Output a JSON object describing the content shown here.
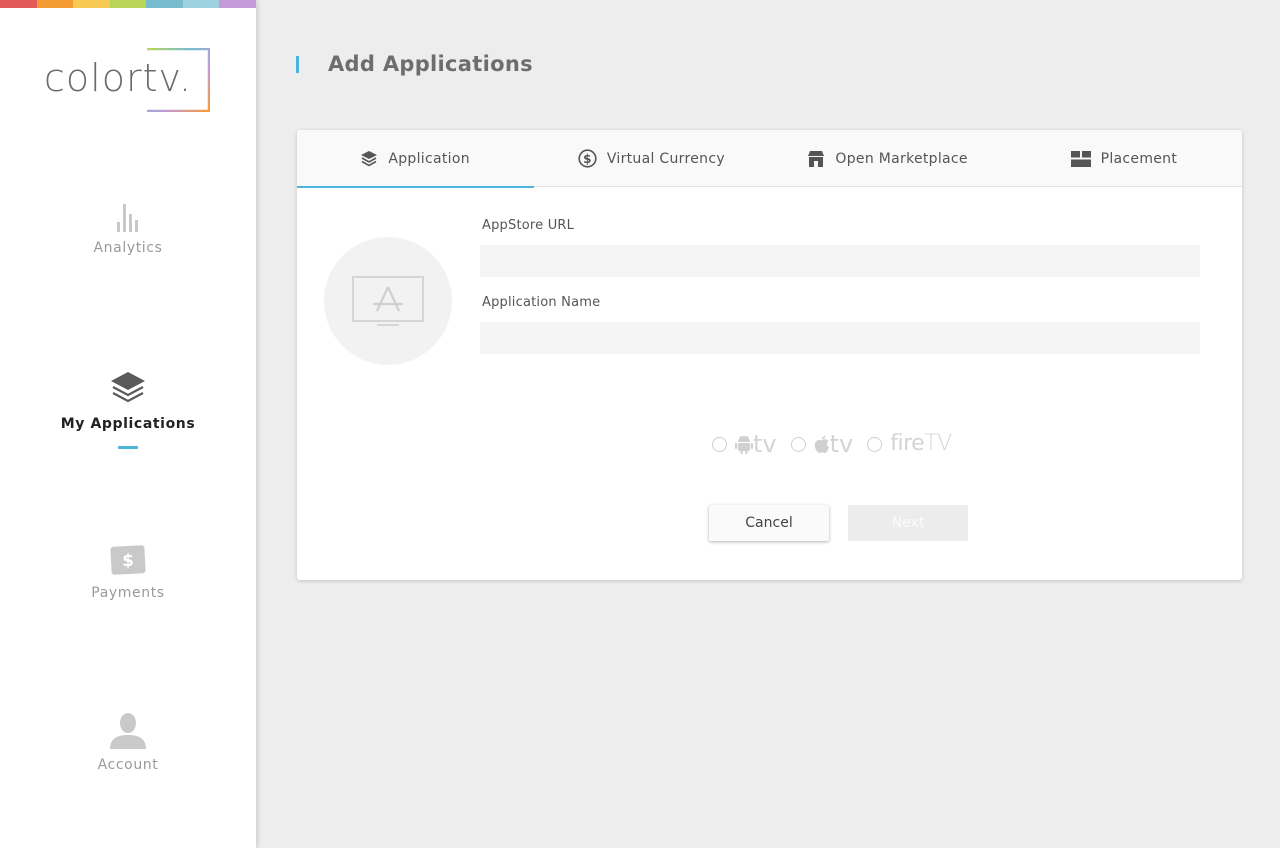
{
  "brand": {
    "logo_text": "colortv.",
    "stripe_colors": [
      "#e25a5a",
      "#f39c36",
      "#f9c955",
      "#b9d65a",
      "#77bccf",
      "#9fd2e0",
      "#c59ad8"
    ]
  },
  "sidebar": {
    "items": [
      {
        "label": "Analytics",
        "icon": "bar-chart-icon",
        "active": false
      },
      {
        "label": "My Applications",
        "icon": "layers-icon",
        "active": true
      },
      {
        "label": "Payments",
        "icon": "dollar-bill-icon",
        "active": false
      },
      {
        "label": "Account",
        "icon": "user-icon",
        "active": false
      }
    ]
  },
  "page": {
    "title": "Add Applications"
  },
  "tabs": [
    {
      "label": "Application",
      "icon": "layers-icon",
      "active": true
    },
    {
      "label": "Virtual Currency",
      "icon": "dollar-circle-icon",
      "active": false
    },
    {
      "label": "Open Marketplace",
      "icon": "store-icon",
      "active": false
    },
    {
      "label": "Placement",
      "icon": "grid-layout-icon",
      "active": false
    }
  ],
  "form": {
    "appstore_url": {
      "label": "AppStore URL",
      "value": "",
      "placeholder": ""
    },
    "app_name": {
      "label": "Application Name",
      "value": "",
      "placeholder": ""
    }
  },
  "platforms": [
    {
      "name": "android tv",
      "text": "tv",
      "icon": "android-icon"
    },
    {
      "name": "apple tv",
      "text": "tv",
      "icon": "apple-icon"
    },
    {
      "name": "fire tv",
      "text_a": "fire",
      "text_b": "TV"
    }
  ],
  "buttons": {
    "cancel": "Cancel",
    "next": "Next"
  },
  "colors": {
    "accent": "#4bb6d9",
    "sidebar_bg": "#ffffff",
    "page_bg": "#ededed"
  }
}
